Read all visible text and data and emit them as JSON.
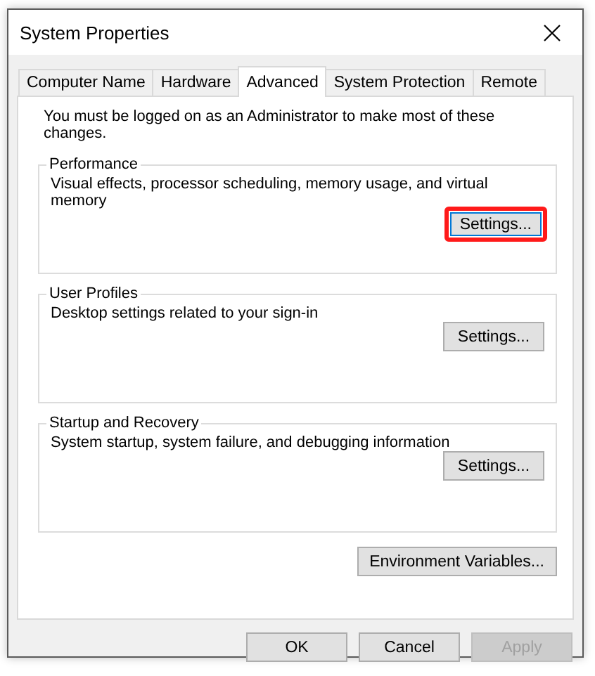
{
  "window": {
    "title": "System Properties"
  },
  "tabs": [
    {
      "label": "Computer Name",
      "selected": false
    },
    {
      "label": "Hardware",
      "selected": false
    },
    {
      "label": "Advanced",
      "selected": true
    },
    {
      "label": "System Protection",
      "selected": false
    },
    {
      "label": "Remote",
      "selected": false
    }
  ],
  "notice": "You must be logged on as an Administrator to make most of these changes.",
  "groups": [
    {
      "title": "Performance",
      "description": "Visual effects, processor scheduling, memory usage, and virtual memory",
      "button": {
        "label": "Settings...",
        "highlighted": true
      }
    },
    {
      "title": "User Profiles",
      "description": "Desktop settings related to your sign-in",
      "button": {
        "label": "Settings...",
        "highlighted": false
      }
    },
    {
      "title": "Startup and Recovery",
      "description": "System startup, system failure, and debugging information",
      "button": {
        "label": "Settings...",
        "highlighted": false
      }
    }
  ],
  "environment_button": "Environment Variables...",
  "buttons": [
    {
      "label": "OK",
      "disabled": false
    },
    {
      "label": "Cancel",
      "disabled": false
    },
    {
      "label": "Apply",
      "disabled": true
    }
  ]
}
